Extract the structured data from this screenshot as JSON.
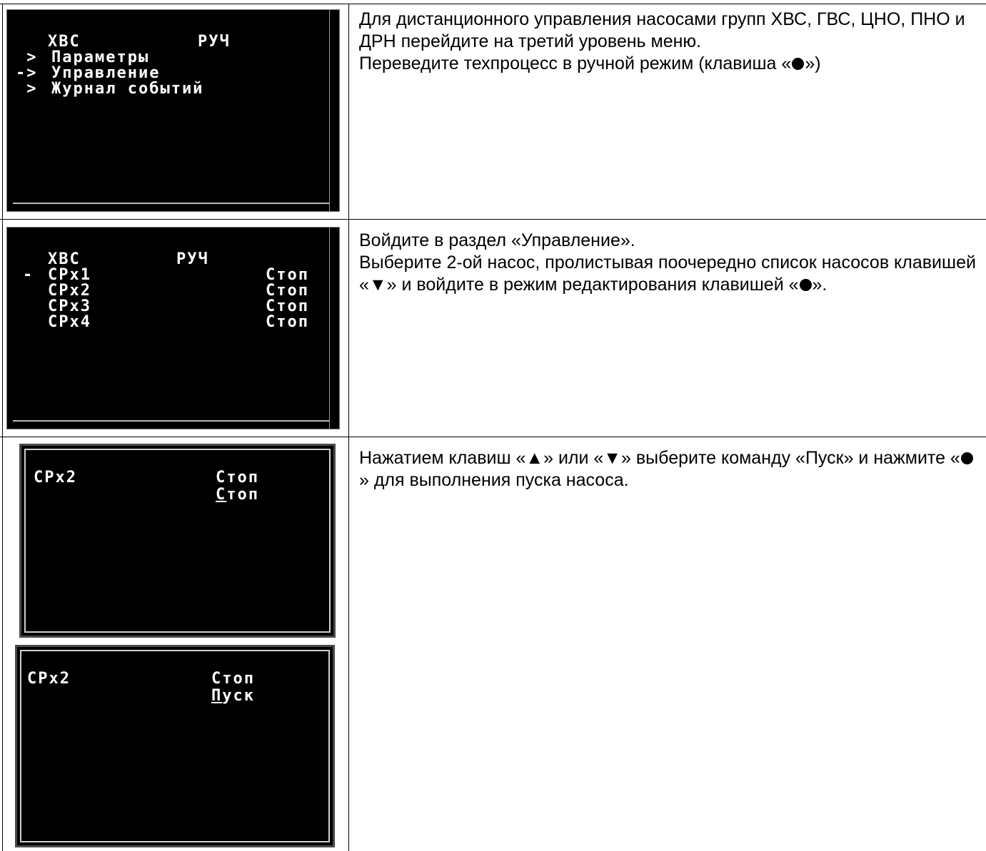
{
  "rows": [
    {
      "screen": {
        "header_left": "ХВС",
        "header_right": "РУЧ",
        "menu": [
          {
            "marker": " >",
            "label": "Параметры"
          },
          {
            "marker": "->",
            "label": "Управление"
          },
          {
            "marker": " >",
            "label": "Журнал событий"
          }
        ]
      },
      "instructions": {
        "line1": "Для дистанционного управления насосами групп ХВС, ГВС, ЦНО, ПНО и ДРН перейдите на третий уровень меню.",
        "line2_before": "Переведите техпроцесс в ручной режим (клавиша «",
        "line2_after": "»)"
      }
    },
    {
      "screen": {
        "header_left": "ХВС",
        "header_right": "РУЧ",
        "pumps": [
          {
            "marker": "-",
            "name": "СРх1",
            "state": "Стоп"
          },
          {
            "marker": " ",
            "name": "СРх2",
            "state": "Стоп"
          },
          {
            "marker": " ",
            "name": "СРх3",
            "state": "Стоп"
          },
          {
            "marker": " ",
            "name": "СРх4",
            "state": "Стоп"
          }
        ]
      },
      "instructions": {
        "line1": "Войдите в раздел «Управление».",
        "line2": "Выберите 2-ой насос, пролистывая поочередно список насосов клавишей «▼» и войдите в режим редактирования клавишей «",
        "line2_end": "»."
      }
    },
    {
      "screens": [
        {
          "pump": "СРх2",
          "state": "Стоп",
          "command_first": "С",
          "command_rest": "топ"
        },
        {
          "pump": "СРх2",
          "state": "Стоп",
          "command_first": "П",
          "command_rest": "уск"
        }
      ],
      "instructions": {
        "text_before": "Нажатием клавиш «▲» или «▼» выберите команду «Пуск» и нажмите «",
        "text_after": "» для выполнения пуска насоса."
      }
    }
  ]
}
